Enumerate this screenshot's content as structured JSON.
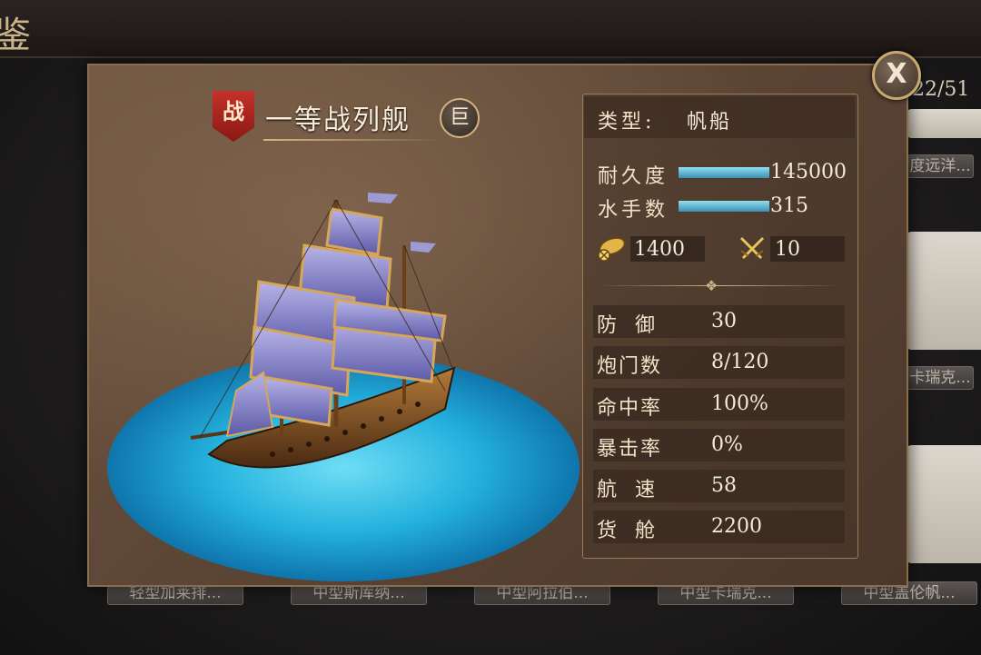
{
  "header": {
    "title_glyph": "鉴"
  },
  "page_count": "22/51",
  "ship": {
    "combat_badge": "战",
    "name": "一等战列舰",
    "size_badge": "巨"
  },
  "stats": {
    "type_label": "类型:",
    "type_value": "帆船",
    "durability_label": "耐久度",
    "durability_value": "145000",
    "durability_fill": 1.0,
    "sailors_label": "水手数",
    "sailors_value": "315",
    "sailors_fill": 1.0,
    "cannon_value": "1400",
    "melee_value": "10",
    "rows": [
      {
        "label": "防御",
        "value": "30"
      },
      {
        "label": "炮门数",
        "value": "8/120"
      },
      {
        "label": "命中率",
        "value": "100%"
      },
      {
        "label": "暴击率",
        "value": "0%"
      },
      {
        "label": "航速",
        "value": "58"
      },
      {
        "label": "货舱",
        "value": "2200"
      }
    ]
  },
  "background_cards": {
    "top_row_labels": [
      "",
      "",
      "",
      ""
    ],
    "right_top_label": "度远洋...",
    "right_mid_label": "卡瑞克...",
    "bottom_labels": [
      "轻型加莱排...",
      "中型斯库纳...",
      "中型阿拉伯...",
      "中型卡瑞克...",
      "中型盖伦帆..."
    ]
  },
  "close_label": "X",
  "icons": {
    "close": "close-icon",
    "cannon": "cannon-icon",
    "swords": "crossed-swords-icon"
  }
}
